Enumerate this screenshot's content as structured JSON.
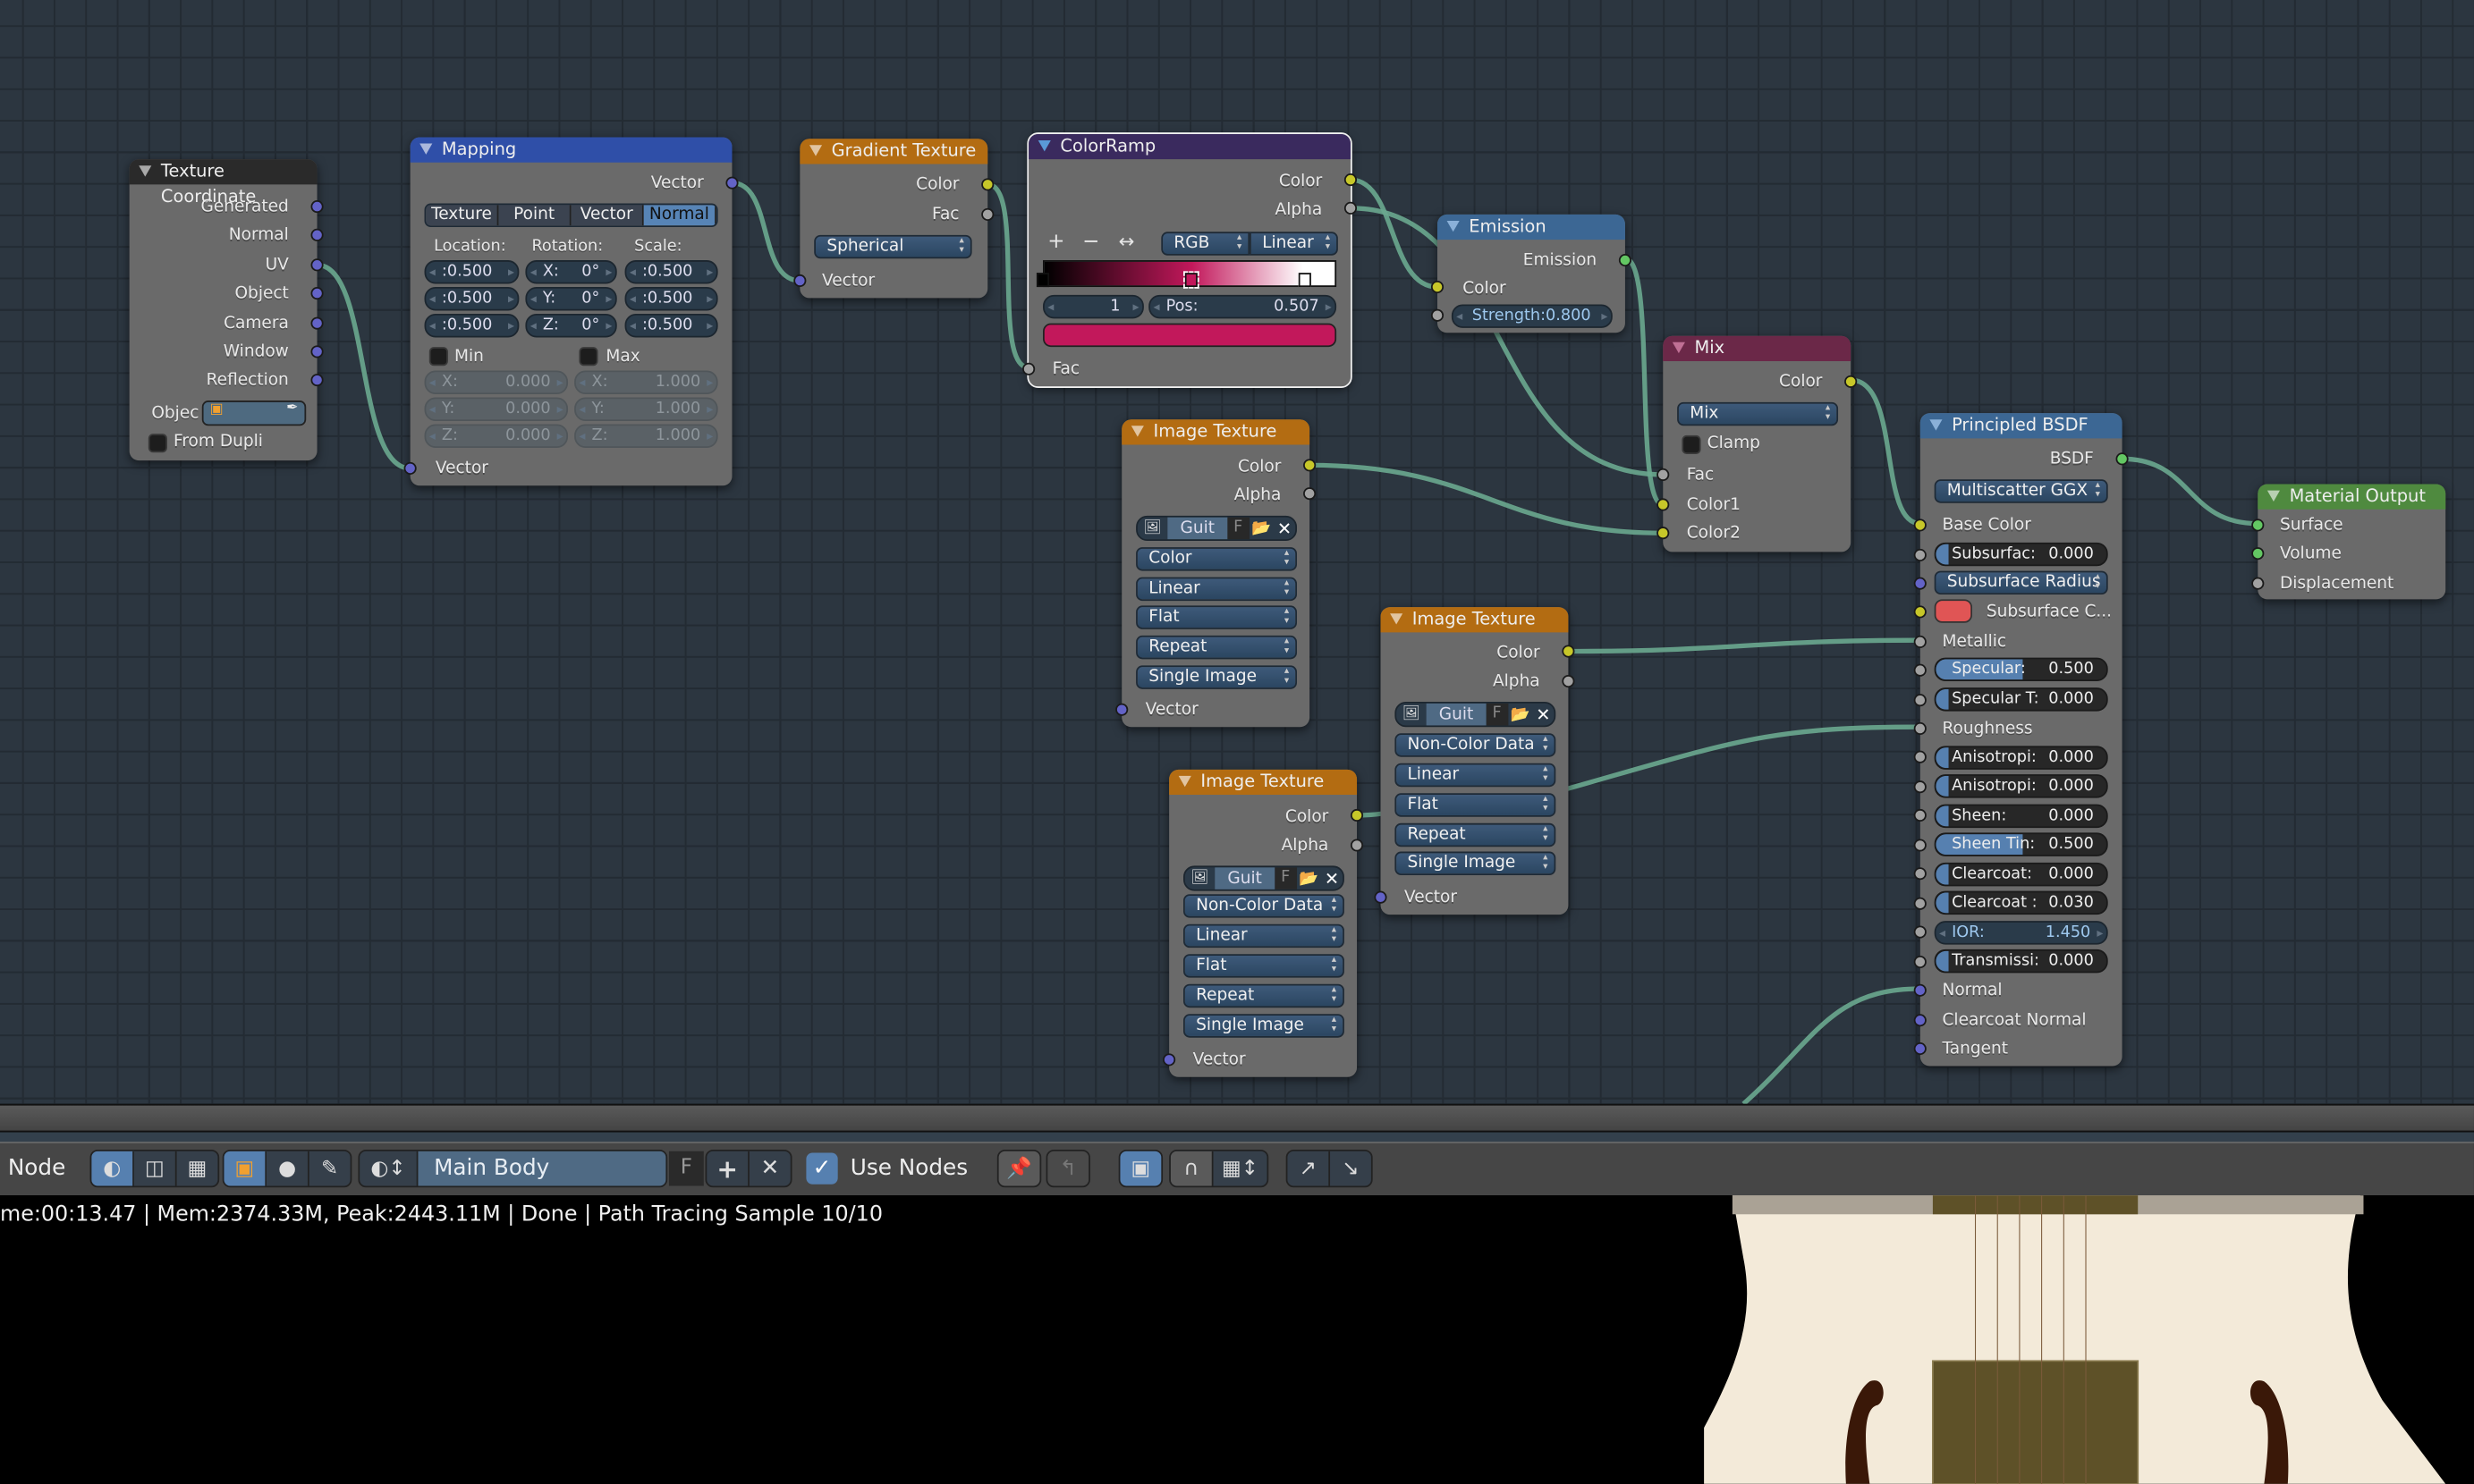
{
  "editor": {
    "mode_label": "Node",
    "material_name": "Main Body",
    "fake_user_label": "F",
    "use_nodes_label": "Use Nodes",
    "use_nodes_checked": true
  },
  "status": {
    "text": "me:00:13.47 | Mem:2374.33M, Peak:2443.11M | Done | Path Tracing Sample 10/10"
  },
  "colors": {
    "texture_header": "#b36c12",
    "mapping_header": "#2f4fa8",
    "colorramp_header": "#3a2a5e",
    "shader_header": "#3c6794",
    "mix_header": "#6b2848",
    "output_header": "#4f8a3f",
    "input_header": "#2a2a2a",
    "wire": "#6aa88f"
  },
  "nodes": {
    "texcoord": {
      "title": "Texture Coordinate",
      "outputs": [
        "Generated",
        "Normal",
        "UV",
        "Object",
        "Camera",
        "Window",
        "Reflection"
      ],
      "object_label": "Objec",
      "from_dupli": "From Dupli"
    },
    "mapping": {
      "title": "Mapping",
      "output": "Vector",
      "types": [
        "Texture",
        "Point",
        "Vector",
        "Normal"
      ],
      "active_type": "Normal",
      "loc_label": "Location:",
      "rot_label": "Rotation:",
      "scale_label": "Scale:",
      "location": [
        ":0.500",
        ":0.500",
        ":0.500"
      ],
      "rotation": [
        {
          "axis": "X:",
          "value": "0°"
        },
        {
          "axis": "Y:",
          "value": "0°"
        },
        {
          "axis": "Z:",
          "value": "0°"
        }
      ],
      "scale": [
        ":0.500",
        ":0.500",
        ":0.500"
      ],
      "min_label": "Min",
      "max_label": "Max",
      "min": [
        {
          "axis": "X:",
          "value": "0.000"
        },
        {
          "axis": "Y:",
          "value": "0.000"
        },
        {
          "axis": "Z:",
          "value": "0.000"
        }
      ],
      "max": [
        {
          "axis": "X:",
          "value": "1.000"
        },
        {
          "axis": "Y:",
          "value": "1.000"
        },
        {
          "axis": "Z:",
          "value": "1.000"
        }
      ],
      "input": "Vector"
    },
    "gradient": {
      "title": "Gradient Texture",
      "outputs": [
        "Color",
        "Fac"
      ],
      "type": "Spherical",
      "input": "Vector"
    },
    "colorramp": {
      "title": "ColorRamp",
      "outputs": [
        "Color",
        "Alpha"
      ],
      "mode": "RGB",
      "interp": "Linear",
      "index": "1",
      "pos_label": "Pos:",
      "pos_value": "0.507",
      "stop_color": "#c2185b",
      "input": "Fac",
      "stops": [
        {
          "pos": 0.0,
          "color": "#000000"
        },
        {
          "pos": 0.507,
          "color": "#c2185b"
        },
        {
          "pos": 0.89,
          "color": "#ffffff"
        }
      ]
    },
    "emission": {
      "title": "Emission",
      "output": "Emission",
      "input_color": "Color",
      "strength": "Strength:0.800"
    },
    "mix": {
      "title": "Mix",
      "output": "Color",
      "blend": "Mix",
      "clamp": "Clamp",
      "inputs": [
        "Fac",
        "Color1",
        "Color2"
      ]
    },
    "image1": {
      "title": "Image Texture",
      "outputs": [
        "Color",
        "Alpha"
      ],
      "image": "Guit",
      "fake": "F",
      "options": [
        "Color",
        "Linear",
        "Flat",
        "Repeat",
        "Single Image"
      ],
      "input": "Vector"
    },
    "image2": {
      "title": "Image Texture",
      "outputs": [
        "Color",
        "Alpha"
      ],
      "image": "Guit",
      "fake": "F",
      "options": [
        "Non-Color Data",
        "Linear",
        "Flat",
        "Repeat",
        "Single Image"
      ],
      "input": "Vector"
    },
    "image3": {
      "title": "Image Texture",
      "outputs": [
        "Color",
        "Alpha"
      ],
      "image": "Guit",
      "fake": "F",
      "options": [
        "Non-Color Data",
        "Linear",
        "Flat",
        "Repeat",
        "Single Image"
      ],
      "input": "Vector"
    },
    "principled": {
      "title": "Principled BSDF",
      "output": "BSDF",
      "distribution": "Multiscatter GGX",
      "base_color": "Base Color",
      "subsurface_radius": "Subsurface Radius",
      "subsurface_color": "Subsurface C...",
      "subsurface_swatch": "#e05555",
      "metallic": "Metallic",
      "roughness": "Roughness",
      "sliders": [
        {
          "label": "Subsurfac:",
          "value": "0.000",
          "fill": 0.0
        },
        {
          "label": "Specular:",
          "value": "0.500",
          "fill": 0.5
        },
        {
          "label": "Specular T:",
          "value": "0.000",
          "fill": 0.0
        },
        {
          "label": "Anisotropi:",
          "value": "0.000",
          "fill": 0.0
        },
        {
          "label": "Anisotropi:",
          "value": "0.000",
          "fill": 0.0
        },
        {
          "label": "Sheen:",
          "value": "0.000",
          "fill": 0.0
        },
        {
          "label": "Sheen Tin:",
          "value": "0.500",
          "fill": 0.5
        },
        {
          "label": "Clearcoat:",
          "value": "0.000",
          "fill": 0.0
        },
        {
          "label": "Clearcoat :",
          "value": "0.030",
          "fill": 0.03
        },
        {
          "label": "Transmissi:",
          "value": "0.000",
          "fill": 0.0
        }
      ],
      "ior_label": "IOR:",
      "ior_value": "1.450",
      "vec_inputs": [
        "Normal",
        "Clearcoat Normal",
        "Tangent"
      ]
    },
    "output": {
      "title": "Material Output",
      "inputs": [
        "Surface",
        "Volume",
        "Displacement"
      ]
    }
  }
}
